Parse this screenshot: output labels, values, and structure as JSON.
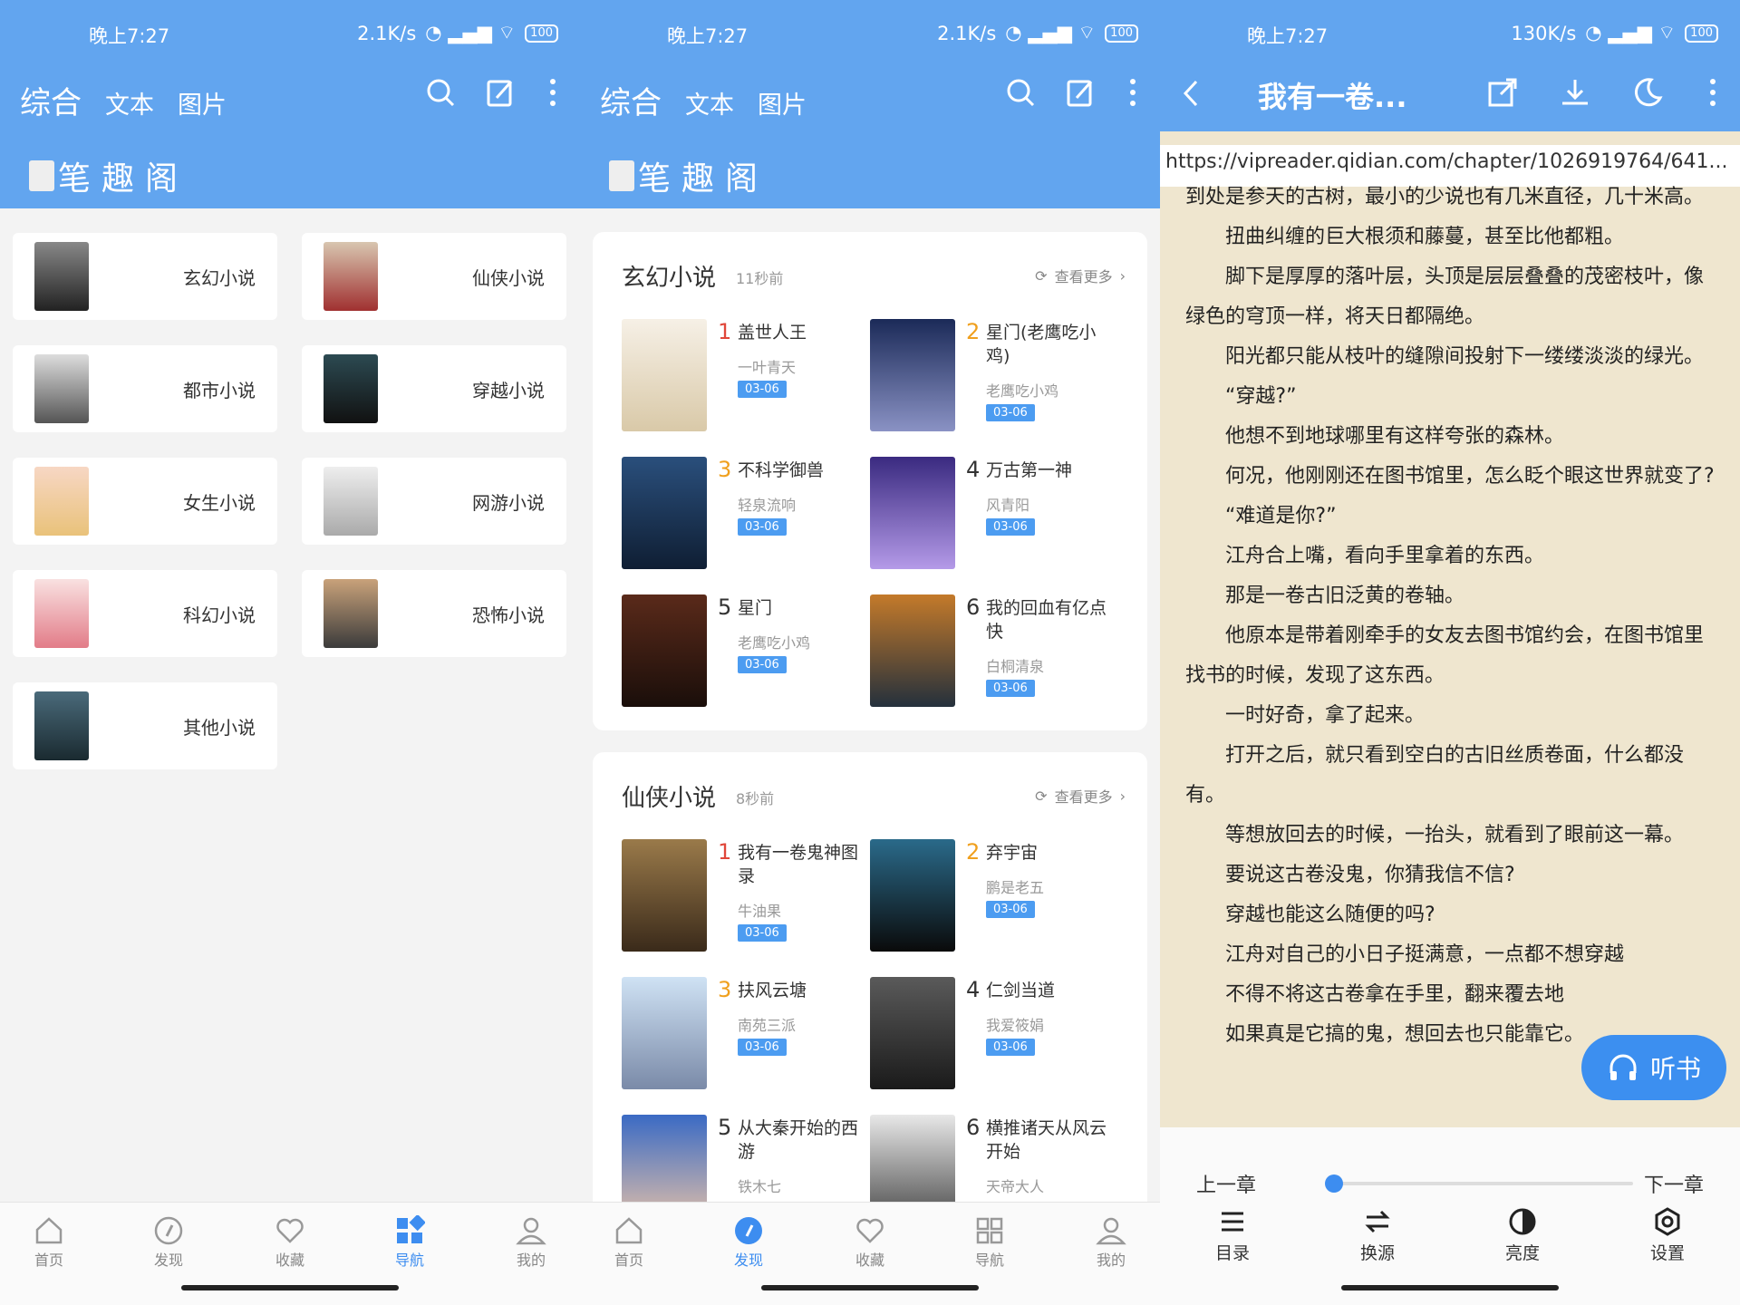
{
  "status": {
    "time": "晚上7:27",
    "speed_left": "2.1K/s",
    "speed_right": "130K/s",
    "battery": "100"
  },
  "top_tabs": [
    "综合",
    "文本",
    "图片"
  ],
  "brand": "笔趣阁",
  "categories": [
    "玄幻小说",
    "仙侠小说",
    "都市小说",
    "穿越小说",
    "女生小说",
    "网游小说",
    "科幻小说",
    "恐怖小说",
    "其他小说"
  ],
  "sections": [
    {
      "title": "玄幻小说",
      "time": "11秒前",
      "more": "查看更多",
      "books": [
        {
          "rank": "1",
          "name": "盖世人王",
          "author": "一叶青天",
          "date": "03-06"
        },
        {
          "rank": "2",
          "name": "星门(老鹰吃小鸡)",
          "author": "老鹰吃小鸡",
          "date": "03-06"
        },
        {
          "rank": "3",
          "name": "不科学御兽",
          "author": "轻泉流响",
          "date": "03-06"
        },
        {
          "rank": "4",
          "name": "万古第一神",
          "author": "风青阳",
          "date": "03-06"
        },
        {
          "rank": "5",
          "name": "星门",
          "author": "老鹰吃小鸡",
          "date": "03-06"
        },
        {
          "rank": "6",
          "name": "我的回血有亿点快",
          "author": "白桐清泉",
          "date": "03-06"
        }
      ]
    },
    {
      "title": "仙侠小说",
      "time": "8秒前",
      "more": "查看更多",
      "books": [
        {
          "rank": "1",
          "name": "我有一卷鬼神图录",
          "author": "牛油果",
          "date": "03-06"
        },
        {
          "rank": "2",
          "name": "弃宇宙",
          "author": "鹏是老五",
          "date": "03-06"
        },
        {
          "rank": "3",
          "name": "扶风云塘",
          "author": "南苑三派",
          "date": "03-06"
        },
        {
          "rank": "4",
          "name": "仁剑当道",
          "author": "我爱筱娟",
          "date": "03-06"
        },
        {
          "rank": "5",
          "name": "从大秦开始的西游",
          "author": "铁木七",
          "date": ""
        },
        {
          "rank": "6",
          "name": "横推诸天从风云开始",
          "author": "天帝大人",
          "date": ""
        }
      ]
    }
  ],
  "nav_left": [
    "首页",
    "发现",
    "收藏",
    "导航",
    "我的"
  ],
  "nav_middle": [
    "首页",
    "发现",
    "收藏",
    "导航",
    "我的"
  ],
  "reader": {
    "title": "我有一卷...",
    "url": "https://vipreader.qidian.com/chapter/1026919764/641...",
    "paragraphs": [
      "到处是参天的古树，最小的少说也有几米直径，几十米高。",
      "扭曲纠缠的巨大根须和藤蔓，甚至比他都粗。",
      "脚下是厚厚的落叶层，头顶是层层叠叠的茂密枝叶，像绿色的穹顶一样，将天日都隔绝。",
      "阳光都只能从枝叶的缝隙间投射下一缕缕淡淡的绿光。",
      "“穿越?”",
      "他想不到地球哪里有这样夸张的森林。",
      "何况，他刚刚还在图书馆里，怎么眨个眼这世界就变了?",
      "“难道是你?”",
      "江舟合上嘴，看向手里拿着的东西。",
      "那是一卷古旧泛黄的卷轴。",
      "他原本是带着刚牵手的女友去图书馆约会，在图书馆里找书的时候，发现了这东西。",
      "一时好奇，拿了起来。",
      "打开之后，就只看到空白的古旧丝质卷面，什么都没有。",
      "等想放回去的时候，一抬头，就看到了眼前这一幕。",
      "要说这古卷没鬼，你猜我信不信?",
      "穿越也能这么随便的吗?",
      "江舟对自己的小日子挺满意，一点都不想穿越",
      "不得不将这古卷拿在手里，翻来覆去地",
      "如果真是它搞的鬼，想回去也只能靠它。"
    ],
    "listen": "听书",
    "prev": "上一章",
    "next": "下一章",
    "progress": 0.0,
    "tools": [
      "目录",
      "换源",
      "亮度",
      "设置"
    ]
  },
  "colors": {
    "header": "#62a5ef",
    "accent": "#3d8df0",
    "paper": "#efe6cf",
    "rank_top": "#e0473a",
    "rank_mid": "#f0a01e"
  }
}
